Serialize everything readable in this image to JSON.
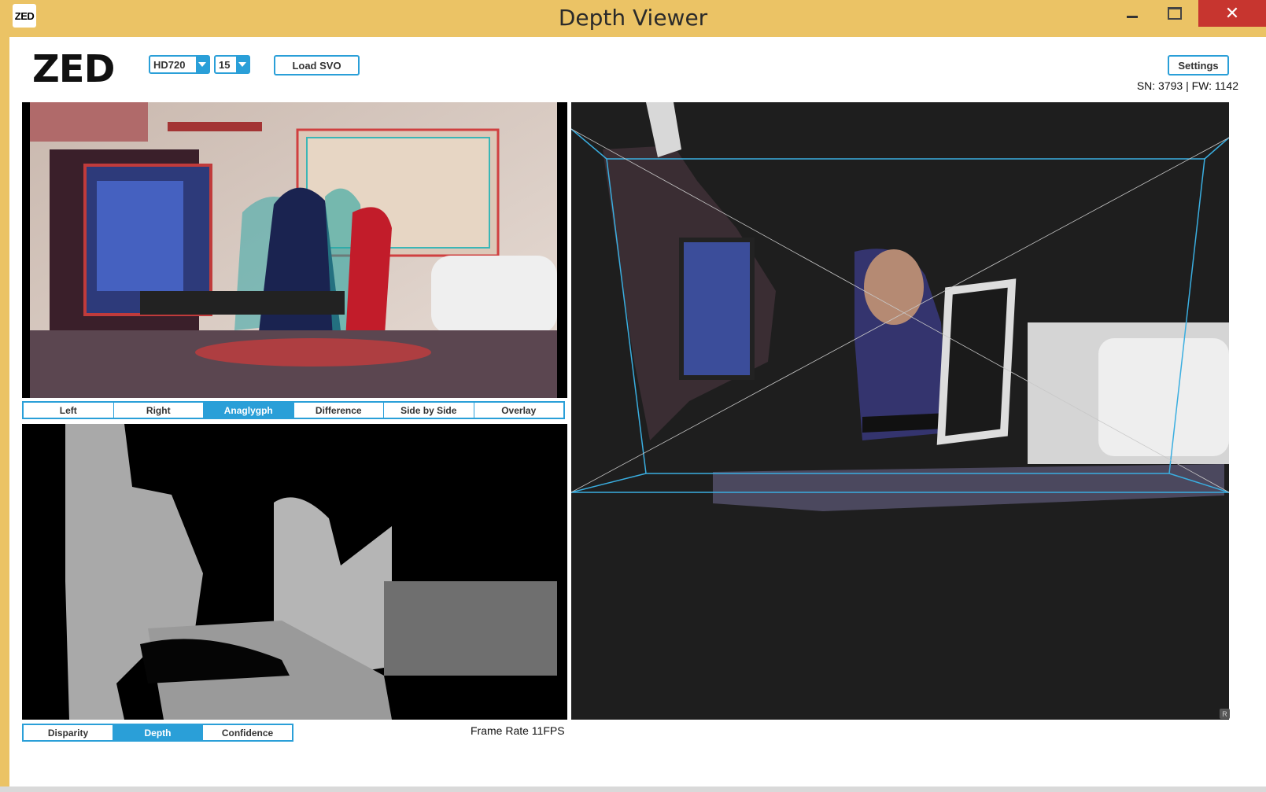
{
  "window": {
    "title": "Depth Viewer",
    "icon_text": "ZED",
    "close_glyph": "✕"
  },
  "toolbar": {
    "logo": "ZED",
    "resolution": "HD720",
    "fps": "15",
    "load_svo_label": "Load SVO",
    "settings_label": "Settings",
    "serial_info": "SN: 3793 | FW: 1142"
  },
  "view_tabs": [
    {
      "label": "Left",
      "active": false
    },
    {
      "label": "Right",
      "active": false
    },
    {
      "label": "Anaglygph",
      "active": true
    },
    {
      "label": "Difference",
      "active": false
    },
    {
      "label": "Side by Side",
      "active": false
    },
    {
      "label": "Overlay",
      "active": false
    }
  ],
  "depth_tabs": [
    {
      "label": "Disparity",
      "active": false
    },
    {
      "label": "Depth",
      "active": true
    },
    {
      "label": "Confidence",
      "active": false
    }
  ],
  "status": {
    "frame_rate": "Frame Rate 11FPS",
    "corner_badge": "R"
  },
  "colors": {
    "accent": "#2a9fd8",
    "titlebar": "#ebc365",
    "close": "#c7352f",
    "cloud_bg": "#1e1e1e"
  }
}
